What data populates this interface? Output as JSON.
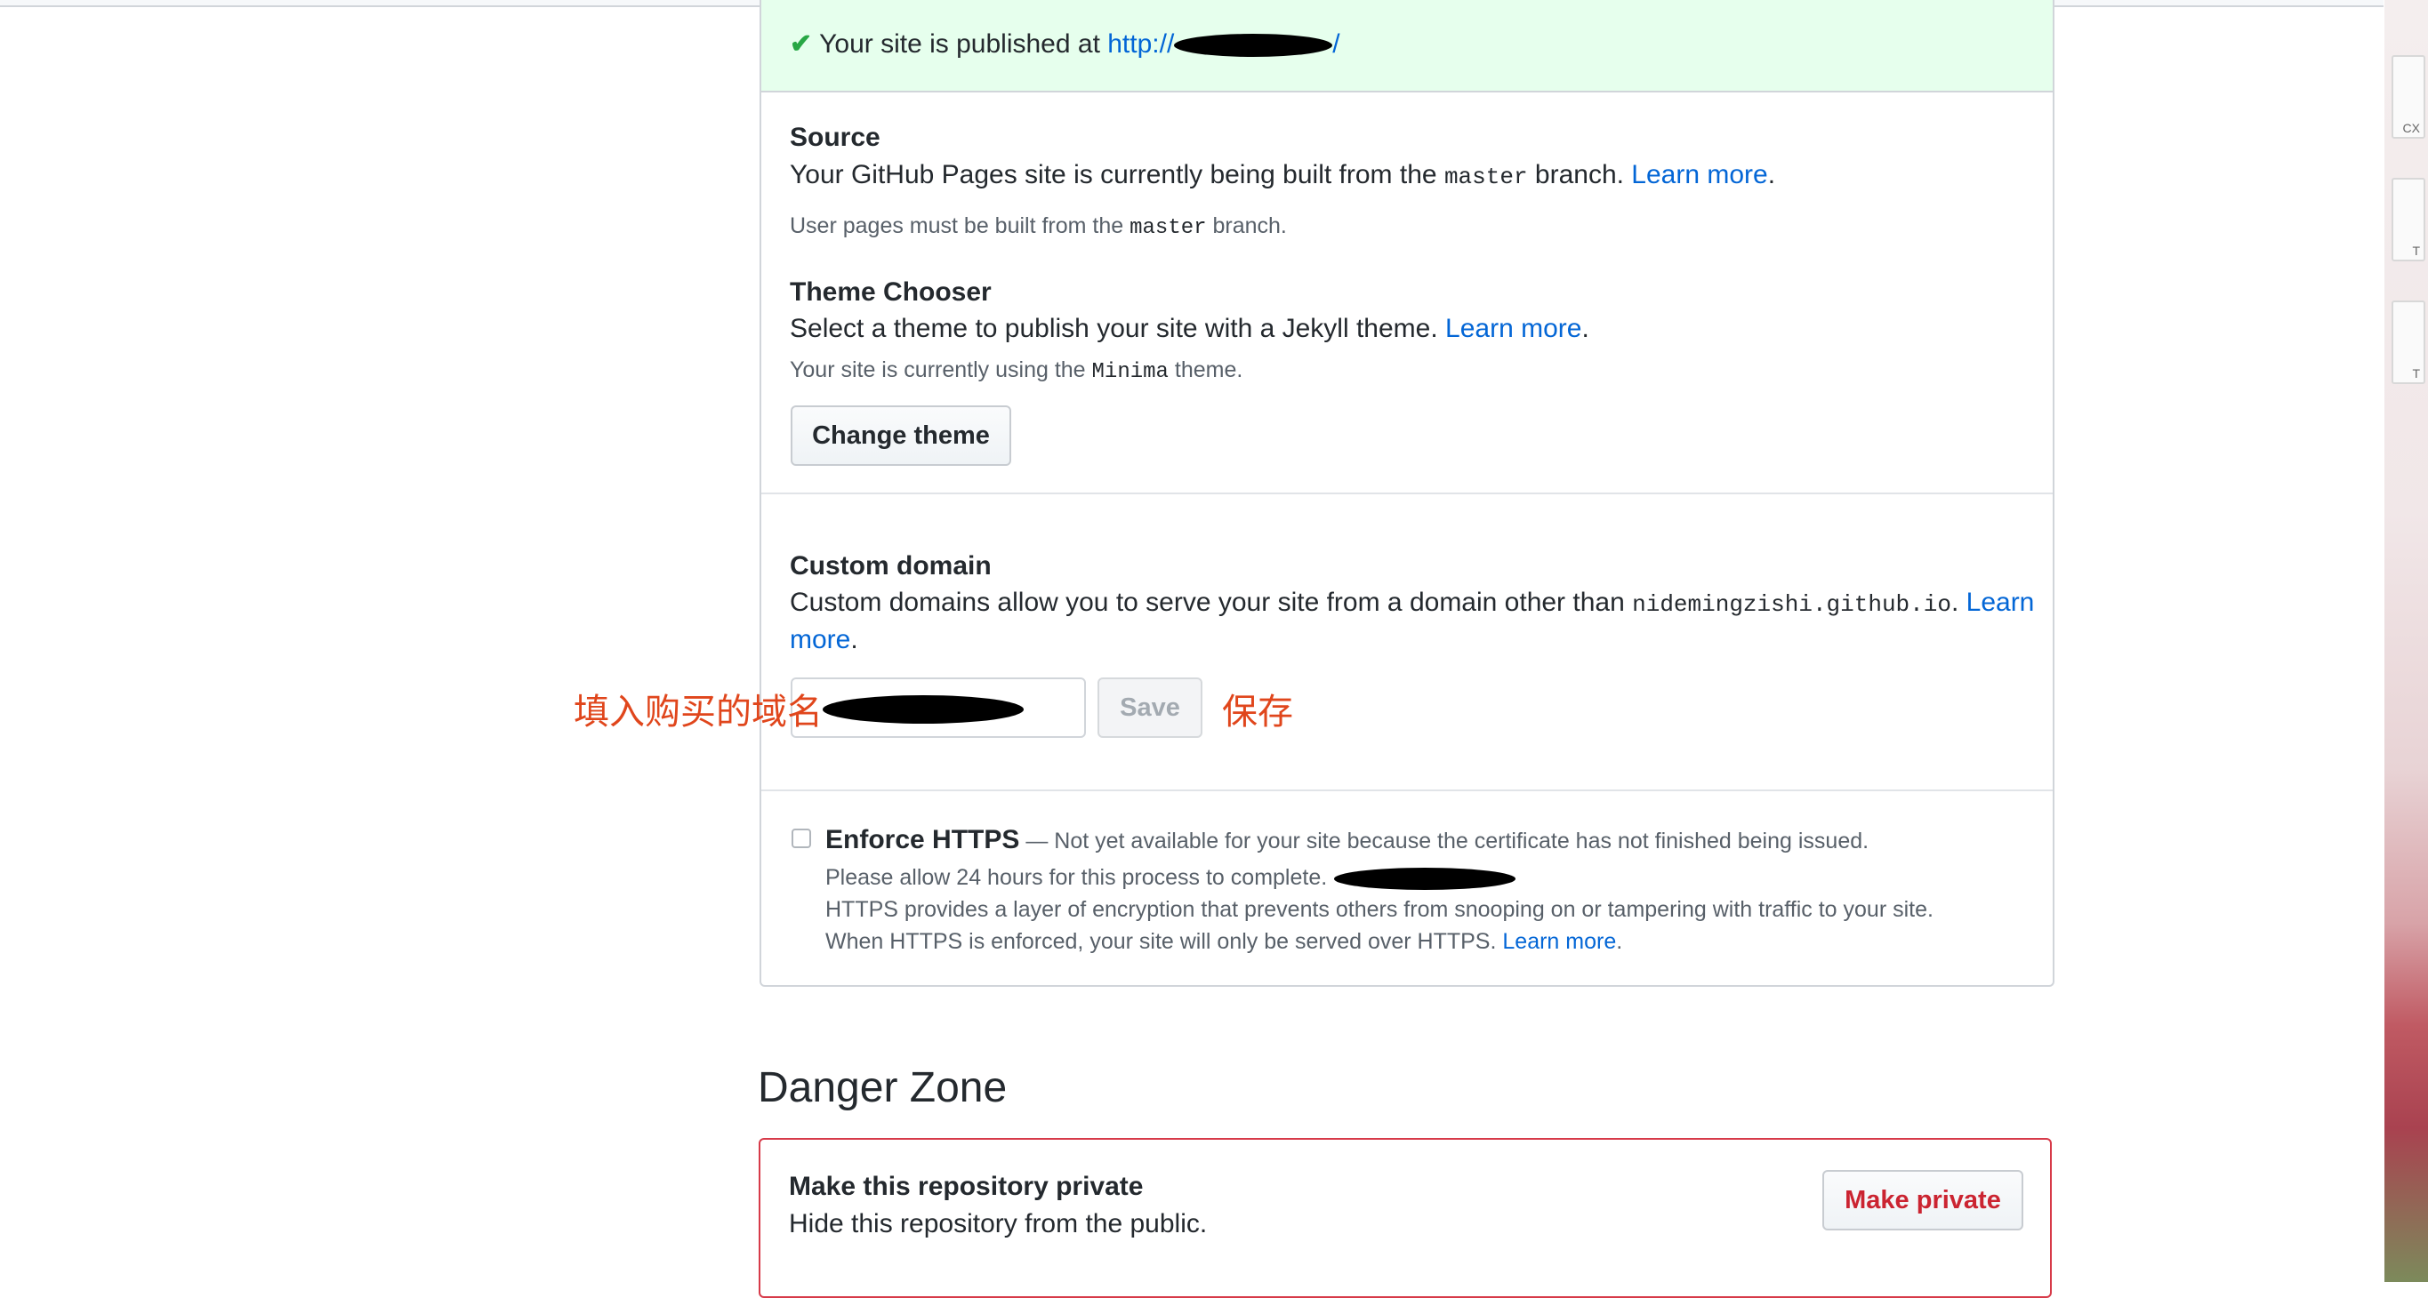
{
  "pages": {
    "flash": {
      "prefix": "Your site is published at ",
      "url_text": "http://",
      "url_suffix": "/"
    },
    "source": {
      "title": "Source",
      "desc_before": "Your GitHub Pages site is currently being built from the ",
      "branch": "master",
      "desc_after": " branch. ",
      "learn_more": "Learn more",
      "period": ".",
      "note_before": "User pages must be built from the ",
      "note_branch": "master",
      "note_after": " branch."
    },
    "theme": {
      "title": "Theme Chooser",
      "desc": "Select a theme to publish your site with a Jekyll theme. ",
      "learn_more": "Learn more",
      "period": ".",
      "note_before": "Your site is currently using the ",
      "theme_name": "Minima",
      "note_after": " theme.",
      "change_button": "Change theme"
    },
    "custom_domain": {
      "title": "Custom domain",
      "desc_before": "Custom domains allow you to serve your site from a domain other than ",
      "domain": "nidemingzishi.github.io",
      "desc_after": ". ",
      "learn_more_1": "Learn",
      "learn_more_2": "more",
      "period": ".",
      "input_value": "",
      "save_button": "Save"
    },
    "https": {
      "label": "Enforce HTTPS",
      "dash_note": " — Not yet available for your site because the certificate has not finished being issued.",
      "line2": "Please allow 24 hours for this process to complete.",
      "line3": "HTTPS provides a layer of encryption that prevents others from snooping on or tampering with traffic to your site.",
      "line4": "When HTTPS is enforced, your site will only be served over HTTPS. ",
      "learn_more": "Learn more",
      "period": ".",
      "checked": false
    },
    "danger_zone": {
      "title": "Danger Zone",
      "private_title": "Make this repository private",
      "private_desc": "Hide this repository from the public.",
      "private_button": "Make private"
    }
  },
  "annotations": {
    "input_hint": "填入购买的域名",
    "save_hint": "保存"
  },
  "colors": {
    "link": "#0366d6",
    "flash_bg": "#e6ffed",
    "danger": "#d73a49",
    "annotation": "#e0461c"
  },
  "icons": {
    "flash": "check-icon"
  }
}
